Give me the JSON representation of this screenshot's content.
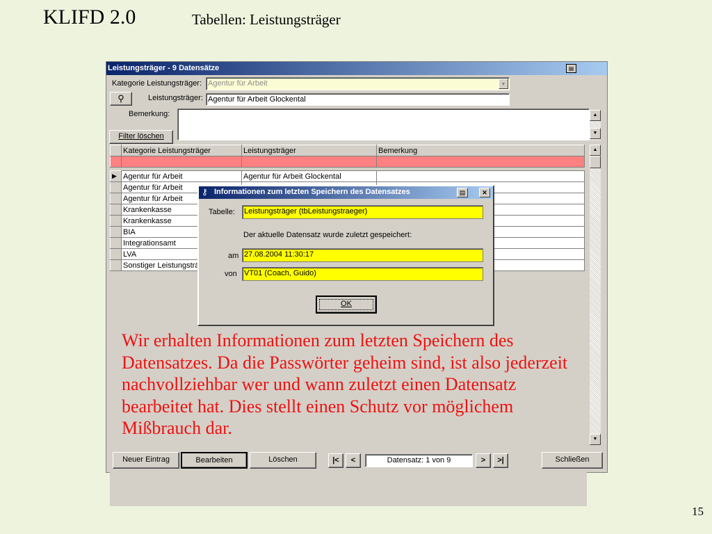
{
  "slide": {
    "title": "KLIFD 2.0",
    "subtitle": "Tabellen: Leistungsträger",
    "page_number": "15"
  },
  "window": {
    "title": "Leistungsträger - 9 Datensätze",
    "kategorie_label": "Kategorie Leistungsträger:",
    "kategorie_value": "Agentur für Arbeit",
    "leistungstraeger_label": "Leistungsträger:",
    "leistungstraeger_value": "Agentur für Arbeit Glockental",
    "bemerkung_label": "Bemerkung:",
    "bemerkung_value": "",
    "filter_button": "Filter löschen",
    "search_icon": "binoculars-icon"
  },
  "grid": {
    "columns": [
      "Kategorie Leistungsträger",
      "Leistungsträger",
      "Bemerkung"
    ],
    "rows": [
      [
        "Agentur für Arbeit",
        "Agentur für Arbeit Glockental",
        ""
      ],
      [
        "Agentur für Arbeit",
        "",
        ""
      ],
      [
        "Agentur für Arbeit",
        "",
        ""
      ],
      [
        "Krankenkasse",
        "",
        ""
      ],
      [
        "Krankenkasse",
        "",
        ""
      ],
      [
        "BIA",
        "",
        ""
      ],
      [
        "Integrationsamt",
        "",
        ""
      ],
      [
        "LVA",
        "",
        ""
      ],
      [
        "Sonstiger Leistungsträ",
        "",
        ""
      ]
    ]
  },
  "footer": {
    "neuer_eintrag": "Neuer Eintrag",
    "bearbeiten": "Bearbeiten",
    "loeschen": "Löschen",
    "record_indicator": "Datensatz: 1 von 9",
    "schliessen": "Schließen",
    "nav_first": "|<",
    "nav_prev": "<",
    "nav_next": ">",
    "nav_last": ">|"
  },
  "dialog": {
    "title": "Informationen zum letzten Speichern des Datensatzes",
    "tabelle_label": "Tabelle:",
    "tabelle_value": "Leistungsträger (tbLeistungstraeger)",
    "info_text": "Der aktuelle Datensatz wurde zuletzt gespeichert:",
    "am_label": "am",
    "am_value": "27.08.2004 11:30:17",
    "von_label": "von",
    "von_value": "VT01 (Coach, Guido)",
    "ok_button": "OK"
  },
  "annotation": "Wir erhalten Informationen zum letzten Speichern des Datensatzes. Da die Passwörter geheim sind, ist also jederzeit nachvollziehbar wer und wann zuletzt einen Datensatz bearbeitet hat. Dies stellt einen Schutz vor möglichem Mißbrauch dar.",
  "colors": {
    "slide_background": "#eef3de",
    "titlebar_start": "#0a246a",
    "titlebar_end": "#a6caf0",
    "filter_row": "#ff8080",
    "dialog_field": "#ffff00",
    "annotation_text": "#ee1111"
  }
}
